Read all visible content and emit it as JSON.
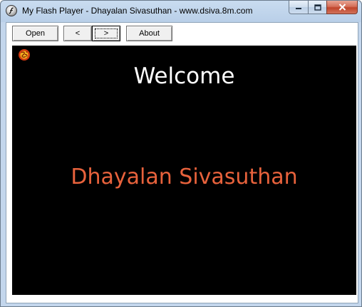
{
  "window": {
    "title": "My Flash Player - Dhayalan Sivasuthan - www.dsiva.8m.com"
  },
  "toolbar": {
    "open_label": "Open",
    "back_label": "<",
    "forward_label": ">",
    "about_label": "About"
  },
  "stage": {
    "heading": "Welcome",
    "name": "Dhayalan Sivasuthan",
    "watermark": "",
    "name_color": "#e8623c",
    "background": "#000000"
  }
}
